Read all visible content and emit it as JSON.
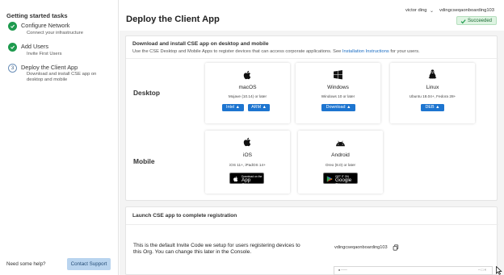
{
  "sidebar": {
    "title": "Getting started tasks",
    "steps": [
      {
        "title": "Configure Network",
        "desc": [
          "Connect your infrastructure"
        ],
        "status": "done"
      },
      {
        "title": "Add Users",
        "desc": [
          "Invite First Users"
        ],
        "status": "done"
      },
      {
        "number": "3",
        "title": "Deploy the Client App",
        "desc": [
          "Download and install CSE app on",
          "desktop and mobile"
        ],
        "status": "current"
      }
    ],
    "help_text": "Need some help?",
    "support_button": "Contact Support"
  },
  "header": {
    "title": "Deploy the Client App",
    "user": "victor ding",
    "tenant": "vdingcseqaonboarding103",
    "status_badge": "Succeeded"
  },
  "download_card": {
    "title": "Download and install CSE app on desktop and mobile",
    "subtitle_prefix": "Use the CSE Desktop and Mobile Apps to register devices that can access corporate applications. See ",
    "subtitle_link": "Installation Instructions",
    "subtitle_suffix": " for your users.",
    "desktop_label": "Desktop",
    "mobile_label": "Mobile",
    "desktop": [
      {
        "icon": "apple-icon",
        "name": "macOS",
        "requirement": "Mojave (10.14) or later",
        "buttons": [
          "Intel",
          "ARM"
        ]
      },
      {
        "icon": "windows-icon",
        "name": "Windows",
        "requirement": "Windows 10 or later",
        "buttons": [
          "Download"
        ]
      },
      {
        "icon": "linux-icon",
        "name": "Linux",
        "requirement": "Ubuntu 18.04+, Fedora 28+",
        "buttons": [
          "DEB"
        ]
      }
    ],
    "mobile": [
      {
        "icon": "apple-icon",
        "name": "iOS",
        "requirement": "iOS 11+, iPadOS 14+",
        "store": {
          "small": "Download on the",
          "large": "App Store"
        }
      },
      {
        "icon": "android-icon",
        "name": "Android",
        "requirement": "Oreo (8.0) or later",
        "store": {
          "small": "GET IT ON",
          "large": "Google Play"
        }
      }
    ]
  },
  "launch_card": {
    "title": "Launch CSE app to complete registration",
    "description": "This is the default Invite Code we setup for users registering devices to this Org. You can change this later in the Console.",
    "invite_code": "vdingcseqaonboarding103"
  },
  "colors": {
    "accent": "#1d75d0",
    "success": "#1e9a4e",
    "support_button": "#b9d4ef"
  }
}
